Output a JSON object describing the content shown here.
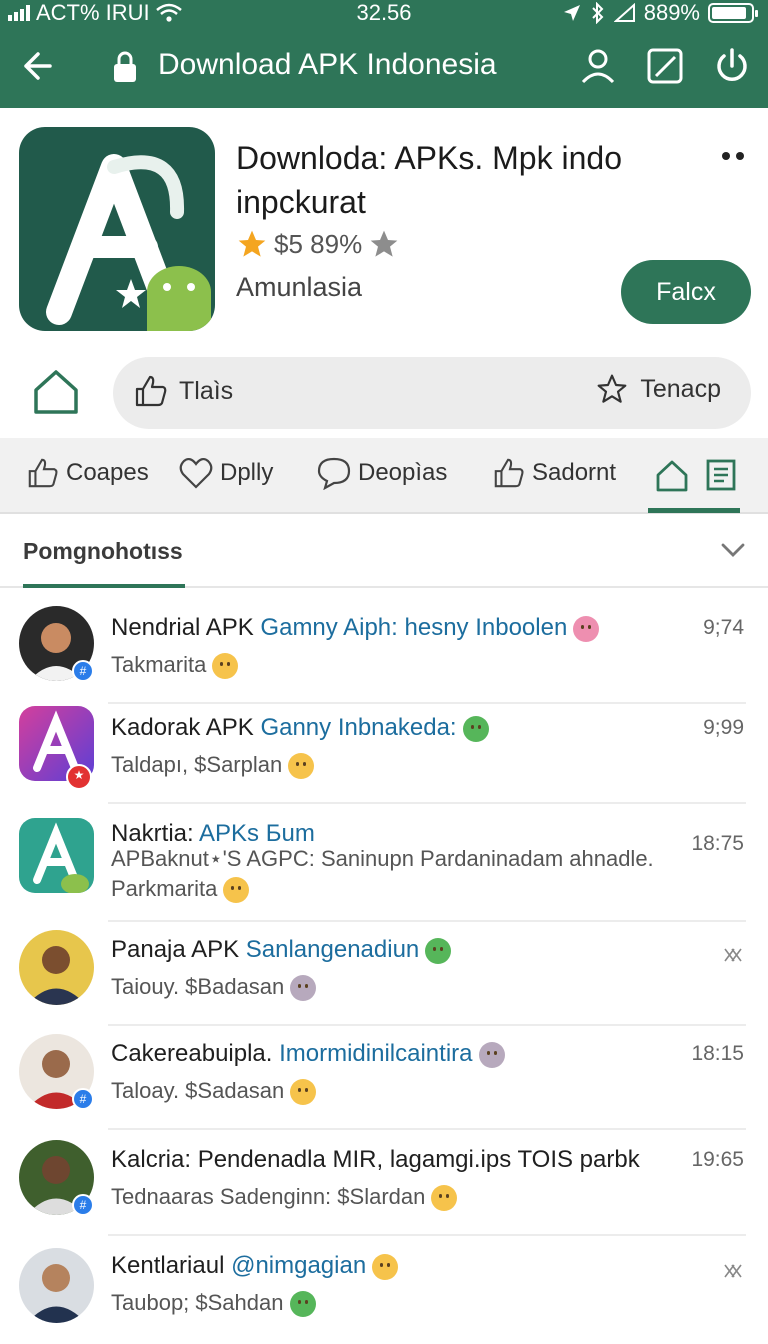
{
  "status_bar": {
    "carrier": "ACT% IRUI",
    "time": "32.56",
    "battery": "889%"
  },
  "app_bar": {
    "title": "Download APK Indonesia",
    "icons": [
      "back-arrow-icon",
      "lock-icon",
      "person-icon",
      "edit-square-icon",
      "power-icon"
    ]
  },
  "app": {
    "name": "Downloda: APKs. Mpk indo inpckurat",
    "rating_text": "$5 89%",
    "publisher": "Amunlasia",
    "install_label": "Falcx",
    "colors": {
      "primary": "#2e7558",
      "icon_bg": "#215a4b",
      "star": "#f4a520"
    }
  },
  "action_row": {
    "like_label": "Tlaìs",
    "star_label": "Tenacp"
  },
  "tabs": [
    {
      "label": "Coapes",
      "icon": "thumbs-up-icon"
    },
    {
      "label": "Dplly",
      "icon": "heart-icon"
    },
    {
      "label": "Deopìas",
      "icon": "chat-bubble-icon"
    },
    {
      "label": "Sadornt",
      "icon": "thumbs-up-icon"
    }
  ],
  "section": {
    "title": "Pomgnohotıss"
  },
  "list": [
    {
      "name": "Nendrial APK ",
      "highlight": "Gamny Aiph: hesny Inboolen",
      "sub": "Takmarita",
      "time": "9;74",
      "emoji_name": "pink",
      "sub_emoji": "yellow"
    },
    {
      "name": "Kadorak APK ",
      "highlight": "Ganny Inbnakeda:",
      "sub": "Taldapı, $Sarplan",
      "time": "9;99",
      "emoji_name": "green",
      "sub_emoji": "yellow"
    },
    {
      "name": "Nakrtia: ",
      "highlight": "APKs Бum",
      "sub": "APBaknut⋆'S AGPC: Saninupn Pardaninadam ahnadle.",
      "sub2": "Parkmarita",
      "time": "18:75",
      "sub_emoji": "yellow"
    },
    {
      "name": "Panaja APK ",
      "highlight": "Sanlangenadiun",
      "sub": "Taiouy. $Badasan",
      "time": "",
      "emoji_name": "green",
      "sub_emoji": "gray"
    },
    {
      "name": "Cakereabuipla. ",
      "highlight": "Imormidinilcaintira",
      "sub": "Taloay. $Sadasan",
      "time": "18:15",
      "emoji_name": "gray",
      "sub_emoji": "yellow"
    },
    {
      "name": "Kalcria: Pendenadla MIR, lagamgi.ips TOIS parbk",
      "highlight": "",
      "sub": "Tednaaras Sadenginn: $Slardan",
      "time": "19:65",
      "sub_emoji": "yellow"
    },
    {
      "name": "Kentlariaul ",
      "highlight": "@nimgagian",
      "sub": "Taubop; $Sahdan",
      "time": "",
      "emoji_name": "yellow",
      "sub_emoji": "green"
    }
  ]
}
